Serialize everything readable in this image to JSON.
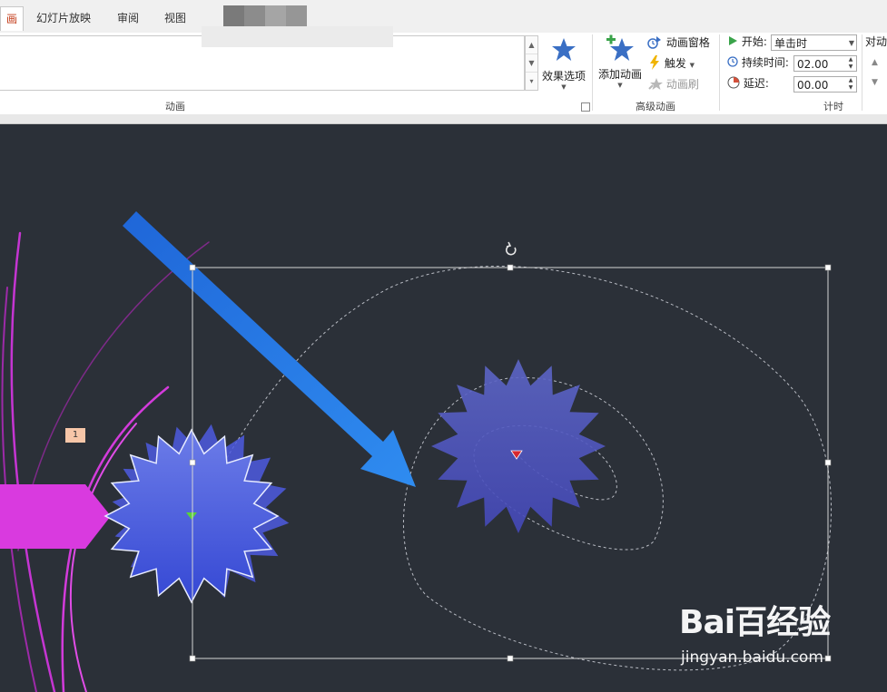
{
  "tabs": [
    {
      "label": "画",
      "active": true
    },
    {
      "label": "幻灯片放映",
      "active": false
    },
    {
      "label": "审阅",
      "active": false
    },
    {
      "label": "视图",
      "active": false
    }
  ],
  "ribbon": {
    "animation_group": {
      "label": "动画",
      "effect_options": "效果选项"
    },
    "advanced_group": {
      "label": "高级动画",
      "add_animation": "添加动画",
      "animation_pane": "动画窗格",
      "trigger": "触发",
      "animation_painter": "动画刷"
    },
    "timing_group": {
      "label": "计时",
      "start_label": "开始:",
      "start_value": "单击时",
      "duration_label": "持续时间:",
      "duration_value": "02.00",
      "delay_label": "延迟:",
      "delay_value": "00.00",
      "reorder_label": "对动"
    }
  },
  "canvas": {
    "animation_badge": "1"
  },
  "watermark": {
    "logo_text": "Bai百经验",
    "url": "jingyan.baidu.com"
  },
  "colors": {
    "accent_tab_text": "#c43e1c",
    "star_blue": "#3f5fd6",
    "slide_bg": "#2b3038",
    "magenta": "#d93adf",
    "arrow_blue": "#2f7de8"
  },
  "icons": {
    "effect_options": "star-icon",
    "add_animation": "star-plus-icon",
    "animation_pane": "animation-pane-icon",
    "trigger": "lightning-icon",
    "animation_painter": "animation-painter-icon",
    "start": "play-icon",
    "duration": "clock-icon",
    "delay": "delay-icon",
    "rotate": "rotate-handle-icon"
  }
}
